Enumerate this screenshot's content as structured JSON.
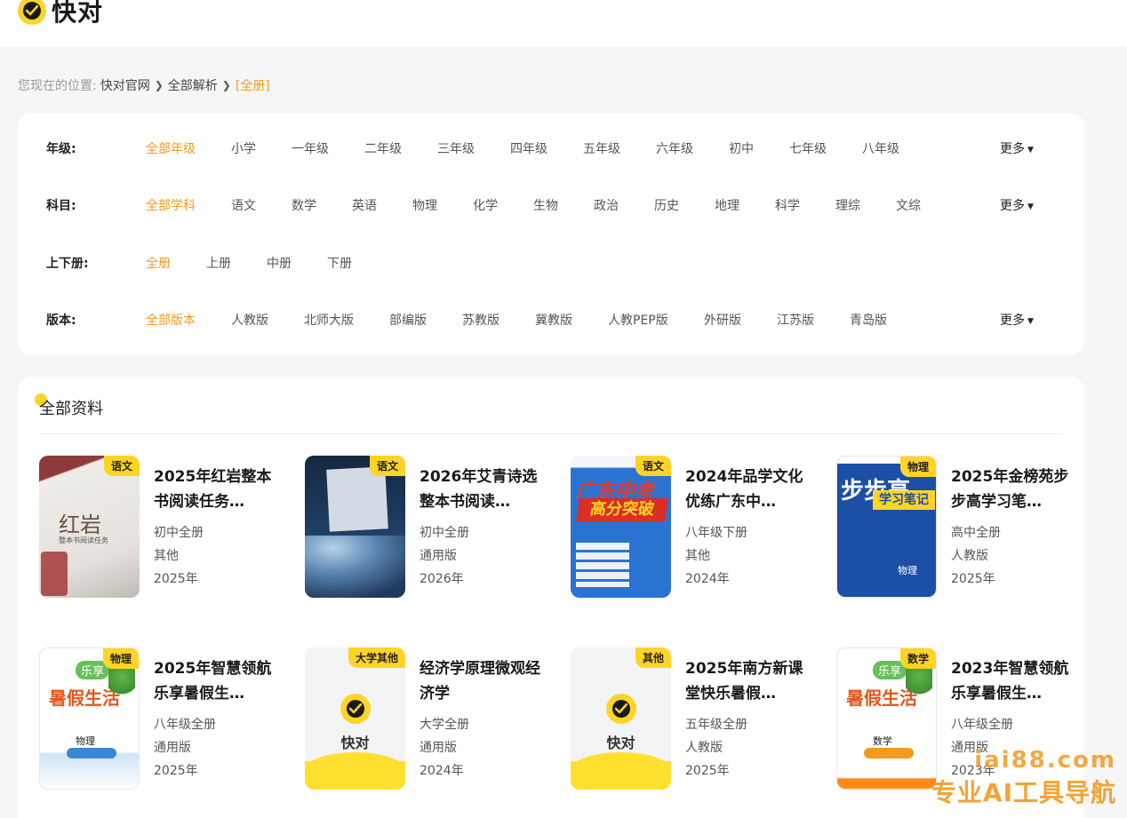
{
  "brand": {
    "name": "快对"
  },
  "breadcrumb": {
    "label": "您现在的位置:",
    "items": [
      "快对官网",
      "全部解析"
    ],
    "current": "[全册]"
  },
  "filters": {
    "more_label": "更多",
    "grade": {
      "label": "年级:",
      "options": [
        "全部年级",
        "小学",
        "一年级",
        "二年级",
        "三年级",
        "四年级",
        "五年级",
        "六年级",
        "初中",
        "七年级",
        "八年级"
      ],
      "selected": "全部年级"
    },
    "subject": {
      "label": "科目:",
      "options": [
        "全部学科",
        "语文",
        "数学",
        "英语",
        "物理",
        "化学",
        "生物",
        "政治",
        "历史",
        "地理",
        "科学",
        "理综",
        "文综"
      ],
      "selected": "全部学科"
    },
    "volume": {
      "label": "上下册:",
      "options": [
        "全册",
        "上册",
        "中册",
        "下册"
      ],
      "selected": "全册"
    },
    "edition": {
      "label": "版本:",
      "options": [
        "全部版本",
        "人教版",
        "北师大版",
        "部编版",
        "苏教版",
        "冀教版",
        "人教PEP版",
        "外研版",
        "江苏版",
        "青岛版"
      ],
      "selected": "全部版本"
    }
  },
  "results": {
    "title": "全部资料",
    "items": [
      {
        "title": "2025年红岩整本书阅读任务…",
        "tag": "语文",
        "grade": "初中全册",
        "edition": "其他",
        "year": "2025年",
        "cover": "hongyan",
        "cover_text": "红岩",
        "cover_sub": "整本书阅读任务"
      },
      {
        "title": "2026年艾青诗选整本书阅读…",
        "tag": "语文",
        "grade": "初中全册",
        "edition": "通用版",
        "year": "2026年",
        "cover": "aiqing"
      },
      {
        "title": "2024年品学文化优练广东中…",
        "tag": "语文",
        "grade": "八年级下册",
        "edition": "其他",
        "year": "2024年",
        "cover": "guangdong",
        "cover_text": "广东中考",
        "cover_sub": "高分突破"
      },
      {
        "title": "2025年金榜苑步步高学习笔…",
        "tag": "物理",
        "grade": "高中全册",
        "edition": "人教版",
        "year": "2025年",
        "cover": "bubugao",
        "cover_text": "步步高",
        "cover_sub": "学习笔记",
        "cover_small": "物理"
      },
      {
        "title": "2025年智慧领航乐享暑假生…",
        "tag": "物理",
        "grade": "八年级全册",
        "edition": "通用版",
        "year": "2025年",
        "cover": "shujia",
        "cover_text": "暑假生活",
        "cover_sub": "物理",
        "cover_badge": "乐享"
      },
      {
        "title": "经济学原理微观经济学",
        "tag": "大学其他",
        "grade": "大学全册",
        "edition": "通用版",
        "year": "2024年",
        "cover": "placeholder",
        "cover_text": "快对"
      },
      {
        "title": "2025年南方新课堂快乐暑假…",
        "tag": "其他",
        "grade": "五年级全册",
        "edition": "人教版",
        "year": "2025年",
        "cover": "placeholder",
        "cover_text": "快对"
      },
      {
        "title": "2023年智慧领航乐享暑假生…",
        "tag": "数学",
        "grade": "八年级全册",
        "edition": "通用版",
        "year": "2023年",
        "cover": "shujia-orange",
        "cover_text": "暑假生活",
        "cover_sub": "数学",
        "cover_badge": "乐享"
      }
    ]
  },
  "watermark": {
    "url": "iai88.com",
    "text": "专业AI工具导航"
  },
  "colors": {
    "accent": "#f39a1e",
    "brand_yellow": "#ffd426",
    "background": "#f5f6f8"
  }
}
